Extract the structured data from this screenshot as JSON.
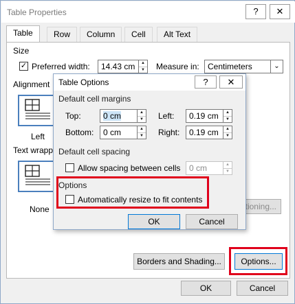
{
  "outer": {
    "title": "Table Properties",
    "help_label": "?",
    "close_label": "✕",
    "tabs": [
      {
        "label": "Table",
        "active": true
      },
      {
        "label": "Row",
        "active": false
      },
      {
        "label": "Column",
        "active": false
      },
      {
        "label": "Cell",
        "active": false
      },
      {
        "label": "Alt Text",
        "active": false
      }
    ],
    "size": {
      "section_label": "Size",
      "preferred_width_label": "Preferred width:",
      "preferred_width_checked": true,
      "preferred_width_value": "14.43 cm",
      "measure_in_label": "Measure in:",
      "measure_in_value": "Centimeters"
    },
    "alignment": {
      "section_label": "Alignment",
      "left_label": "Left"
    },
    "text_wrapping": {
      "section_label": "Text wrapp",
      "none_label": "None"
    },
    "positioning_button": "tioning...",
    "borders_button": "Borders and Shading...",
    "options_button": "Options...",
    "ok_button": "OK",
    "cancel_button": "Cancel"
  },
  "inner": {
    "title": "Table Options",
    "help_label": "?",
    "close_label": "✕",
    "margins": {
      "section_label": "Default cell margins",
      "top_label": "Top:",
      "top_value": "0 cm",
      "bottom_label": "Bottom:",
      "bottom_value": "0 cm",
      "left_label": "Left:",
      "left_value": "0.19 cm",
      "right_label": "Right:",
      "right_value": "0.19 cm"
    },
    "spacing": {
      "section_label": "Default cell spacing",
      "allow_label": "Allow spacing between cells",
      "allow_checked": false,
      "value": "0 cm"
    },
    "options": {
      "section_label": "Options",
      "auto_resize_label": "Automatically resize to fit contents",
      "auto_resize_checked": false
    },
    "ok_button": "OK",
    "cancel_button": "Cancel"
  },
  "colors": {
    "highlight_red": "#e0001b",
    "accent_blue": "#0078d7",
    "selection_blue": "#cce4f7"
  }
}
